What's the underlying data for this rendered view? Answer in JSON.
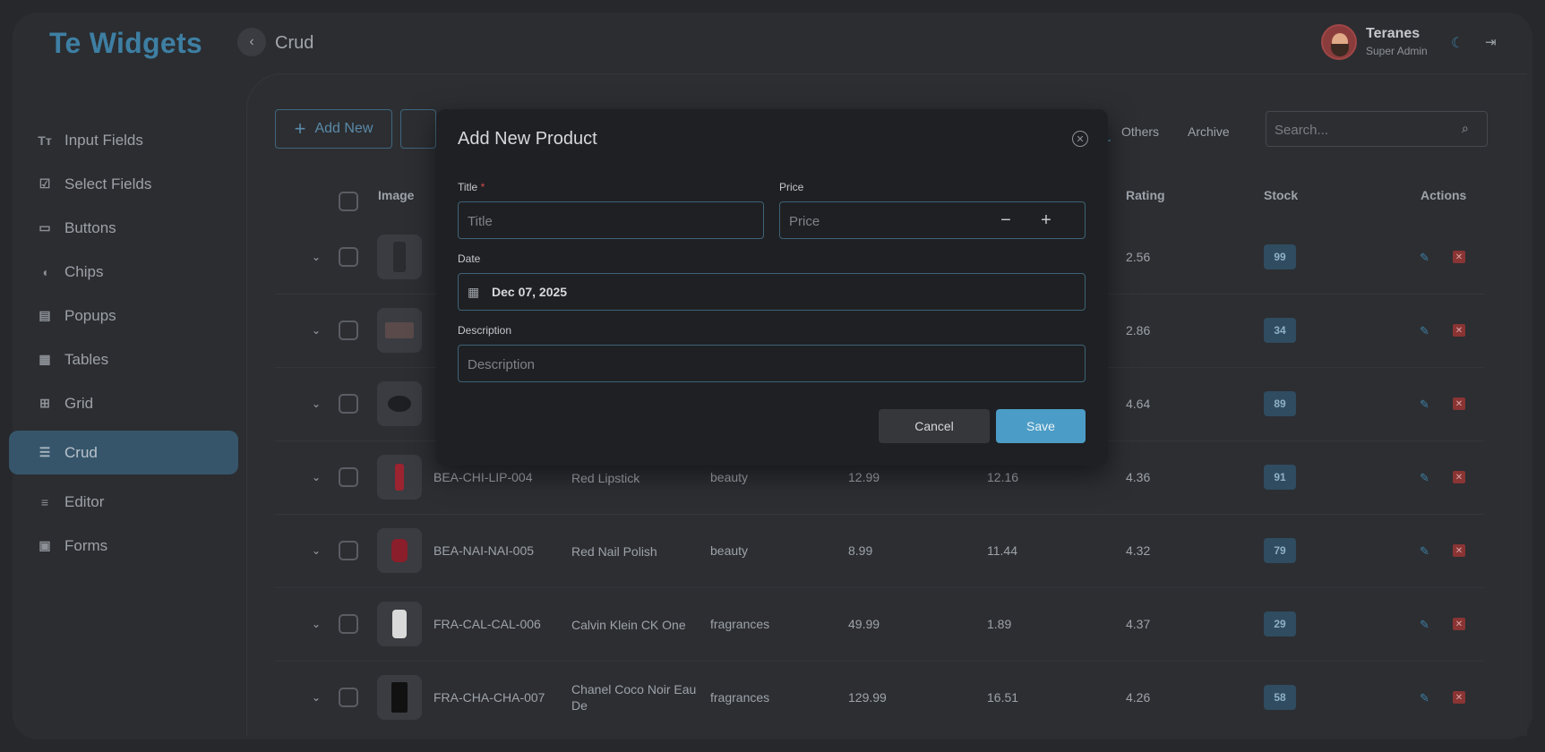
{
  "app": {
    "logo": "Te Widgets",
    "page": "Crud"
  },
  "user": {
    "name": "Teranes",
    "role": "Super Admin"
  },
  "sidebar": {
    "items": [
      {
        "label": "Input Fields",
        "icon": "text-format-icon"
      },
      {
        "label": "Select Fields",
        "icon": "checkbox-icon"
      },
      {
        "label": "Buttons",
        "icon": "button-icon"
      },
      {
        "label": "Chips",
        "icon": "label-icon"
      },
      {
        "label": "Popups",
        "icon": "comment-icon"
      },
      {
        "label": "Tables",
        "icon": "table-icon"
      },
      {
        "label": "Grid",
        "icon": "grid-icon"
      },
      {
        "label": "Crud",
        "icon": "list-icon"
      },
      {
        "label": "Editor",
        "icon": "edit-note-icon"
      },
      {
        "label": "Forms",
        "icon": "clipboard-icon"
      }
    ],
    "active": "Crud"
  },
  "toolbar": {
    "add_new_label": "Add New",
    "filters": [
      "Others",
      "Archive"
    ],
    "search_placeholder": "Search..."
  },
  "table": {
    "headers": {
      "image": "Image",
      "rating": "Rating",
      "stock": "Stock",
      "actions": "Actions"
    },
    "rows": [
      {
        "sku": "",
        "title": "",
        "category": "",
        "price": "",
        "discount": "",
        "rating": "2.56",
        "stock": "99"
      },
      {
        "sku": "",
        "title": "",
        "category": "",
        "price": "",
        "discount": "",
        "rating": "2.86",
        "stock": "34"
      },
      {
        "sku": "",
        "title": "",
        "category": "",
        "price": "",
        "discount": "",
        "rating": "4.64",
        "stock": "89"
      },
      {
        "sku": "BEA-CHI-LIP-004",
        "title": "Red Lipstick",
        "category": "beauty",
        "price": "12.99",
        "discount": "12.16",
        "rating": "4.36",
        "stock": "91"
      },
      {
        "sku": "BEA-NAI-NAI-005",
        "title": "Red Nail Polish",
        "category": "beauty",
        "price": "8.99",
        "discount": "11.44",
        "rating": "4.32",
        "stock": "79"
      },
      {
        "sku": "FRA-CAL-CAL-006",
        "title": "Calvin Klein CK One",
        "category": "fragrances",
        "price": "49.99",
        "discount": "1.89",
        "rating": "4.37",
        "stock": "29"
      },
      {
        "sku": "FRA-CHA-CHA-007",
        "title": "Chanel Coco Noir Eau De",
        "category": "fragrances",
        "price": "129.99",
        "discount": "16.51",
        "rating": "4.26",
        "stock": "58"
      }
    ]
  },
  "modal": {
    "title": "Add New Product",
    "title_label": "Title",
    "title_placeholder": "Title",
    "price_label": "Price",
    "price_placeholder": "Price",
    "date_label": "Date",
    "date_value": "Dec 07, 2025",
    "description_label": "Description",
    "description_placeholder": "Description",
    "cancel_label": "Cancel",
    "save_label": "Save"
  },
  "colors": {
    "accent": "#4b9cc6",
    "brand": "#3e7fa3",
    "danger": "#8a3434",
    "badge": "#2f4c60"
  }
}
